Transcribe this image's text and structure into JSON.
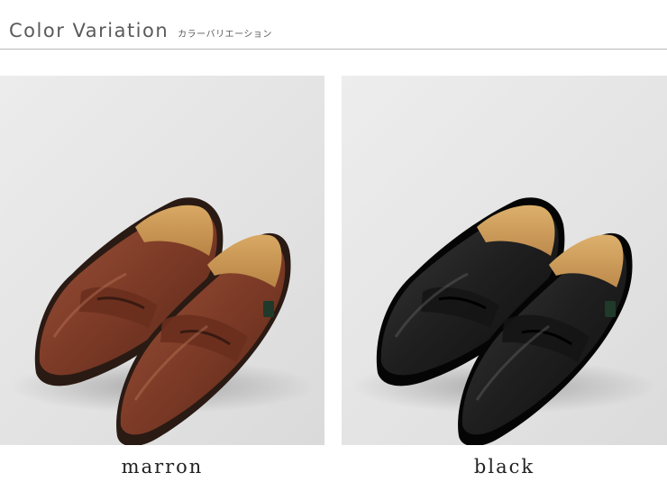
{
  "header": {
    "title": "Color Variation",
    "subtitle": "カラーバリエーション"
  },
  "variations": [
    {
      "label": "marron",
      "color": "#7a3a26"
    },
    {
      "label": "black",
      "color": "#1c1c1c"
    }
  ]
}
